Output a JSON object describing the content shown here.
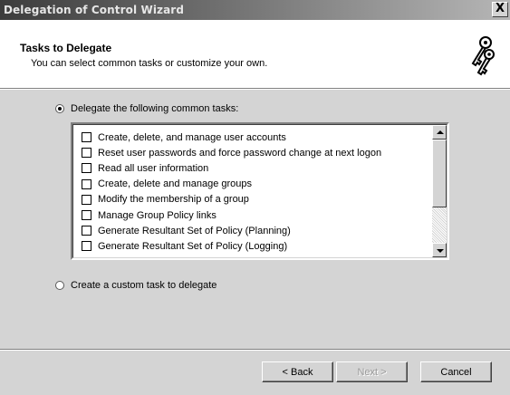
{
  "window": {
    "title": "Delegation of Control Wizard",
    "close_label": "X"
  },
  "header": {
    "title": "Tasks to Delegate",
    "subtitle": "You can select common tasks or customize your own.",
    "icon": "keys-icon"
  },
  "options": {
    "common": {
      "label": "Delegate the following common tasks:",
      "selected": true
    },
    "custom": {
      "label": "Create a custom task to delegate",
      "selected": false
    }
  },
  "tasks": [
    {
      "label": "Create, delete, and manage user accounts",
      "checked": false
    },
    {
      "label": "Reset user passwords and force password change at next logon",
      "checked": false
    },
    {
      "label": "Read all user information",
      "checked": false
    },
    {
      "label": "Create, delete and manage groups",
      "checked": false
    },
    {
      "label": "Modify the membership of a group",
      "checked": false
    },
    {
      "label": "Manage Group Policy links",
      "checked": false
    },
    {
      "label": "Generate Resultant Set of Policy (Planning)",
      "checked": false
    },
    {
      "label": "Generate Resultant Set of Policy (Logging)",
      "checked": false
    }
  ],
  "buttons": {
    "back": "< Back",
    "next": "Next >",
    "cancel": "Cancel"
  },
  "colors": {
    "face": "#d4d4d4",
    "title_start": "#3c3c3c",
    "title_end": "#b6b6b6"
  }
}
